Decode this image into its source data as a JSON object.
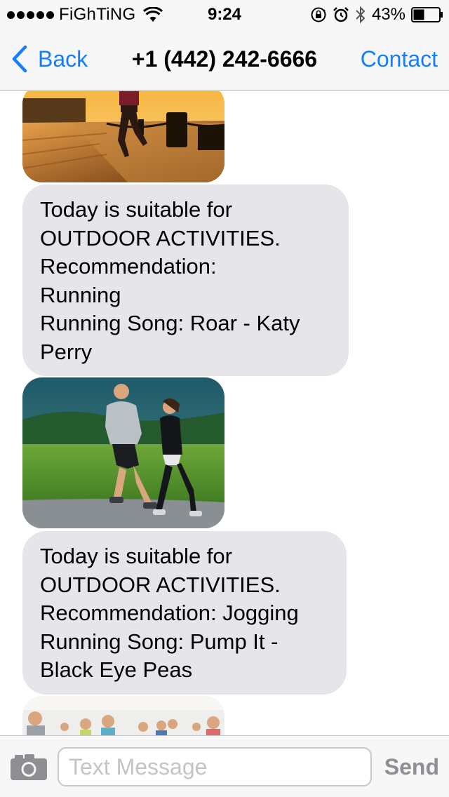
{
  "status_bar": {
    "carrier": "FiGhTiNG",
    "time": "9:24",
    "battery_percent": "43%",
    "battery_level": 0.43,
    "icons": [
      "signal-dots-icon",
      "wifi-icon",
      "orientation-lock-icon",
      "alarm-icon",
      "bluetooth-icon",
      "battery-icon"
    ]
  },
  "nav": {
    "back_label": "Back",
    "title": "+1 (442) 242-6666",
    "contact_label": "Contact",
    "accent_color": "#147efb"
  },
  "messages": [
    {
      "type": "image",
      "description_icon": "running-sunset-photo"
    },
    {
      "type": "text",
      "text": "Today is suitable for\nOUTDOOR ACTIVITIES.\nRecommendation:\nRunning\nRunning Song: Roar - Katy\nPerry"
    },
    {
      "type": "image",
      "description_icon": "jogging-couple-photo"
    },
    {
      "type": "text",
      "text": "Today is suitable for\nOUTDOOR ACTIVITIES.\nRecommendation: Jogging\nRunning Song: Pump It -\nBlack Eye Peas"
    },
    {
      "type": "image",
      "description_icon": "group-fitness-photo"
    }
  ],
  "input_bar": {
    "placeholder": "Text Message",
    "send_label": "Send",
    "bubble_color": "#e5e5ea"
  }
}
